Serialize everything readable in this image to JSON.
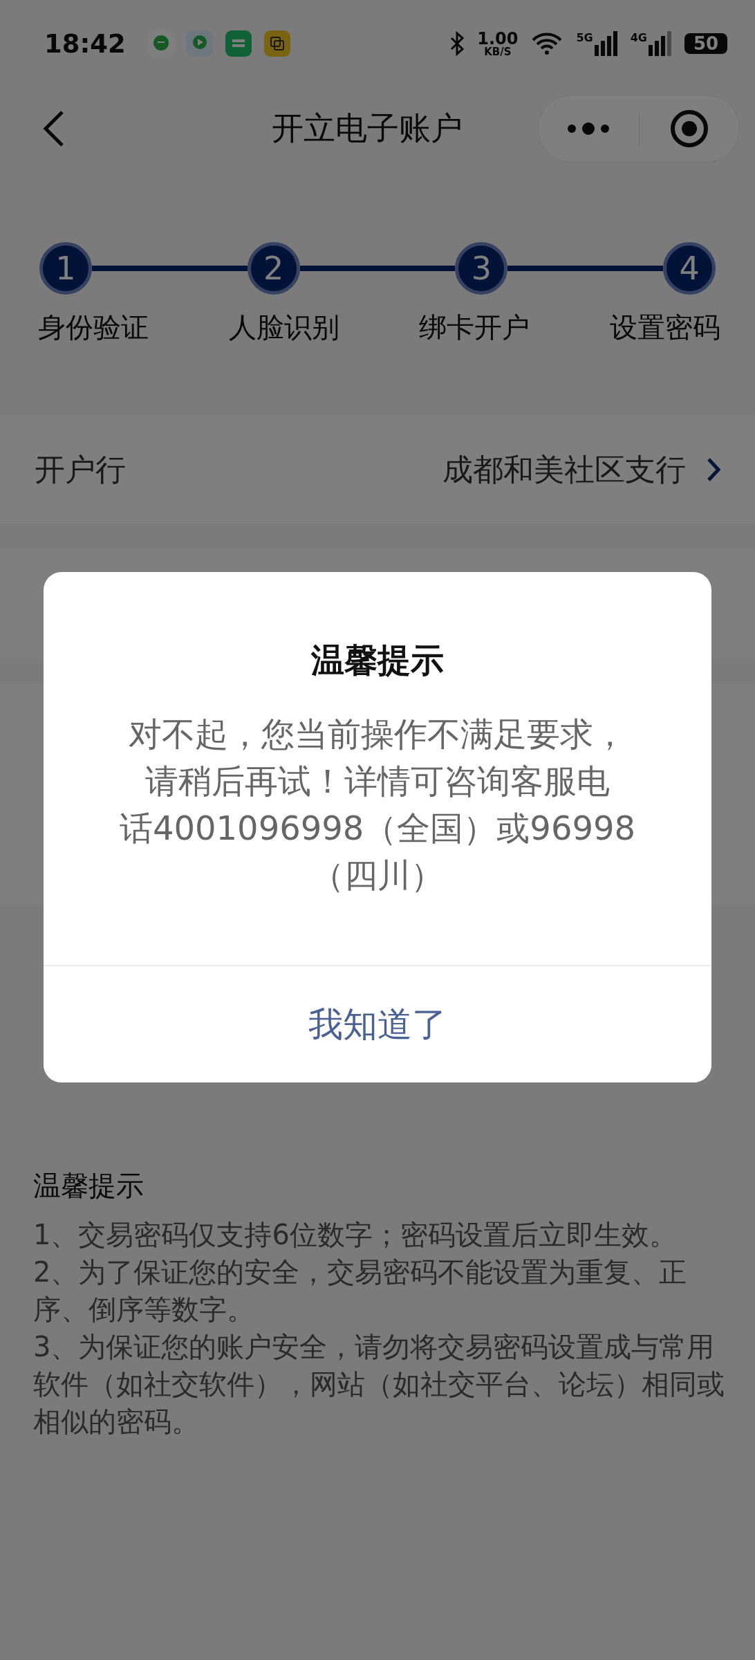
{
  "status_bar": {
    "time": "18:42",
    "net_speed": "1.00",
    "net_unit": "KB/S",
    "signal_1": "5G",
    "signal_2": "4G",
    "battery": "50"
  },
  "nav": {
    "title": "开立电子账户"
  },
  "steps": [
    {
      "number": "1",
      "label": "身份验证"
    },
    {
      "number": "2",
      "label": "人脸识别"
    },
    {
      "number": "3",
      "label": "绑卡开户"
    },
    {
      "number": "4",
      "label": "设置密码"
    }
  ],
  "form_rows": [
    {
      "label": "开户行",
      "value": "成都和美社区支行"
    }
  ],
  "dialog": {
    "title": "温馨提示",
    "message_lines": [
      "对不起，您当前操作不满足要求，",
      "请稍后再试！详情可咨询客服电",
      "话4001096998（全国）或96998",
      "（四川）"
    ],
    "button": "我知道了"
  },
  "tips": {
    "title": "温馨提示",
    "items": [
      "1、交易密码仅支持6位数字；密码设置后立即生效。",
      "2、为了保证您的安全，交易密码不能设置为重复、正序、倒序等数字。",
      "3、为保证您的账户安全，请勿将交易密码设置成与常用软件（如社交软件），网站（如社交平台、论坛）相同或相似的密码。"
    ]
  }
}
